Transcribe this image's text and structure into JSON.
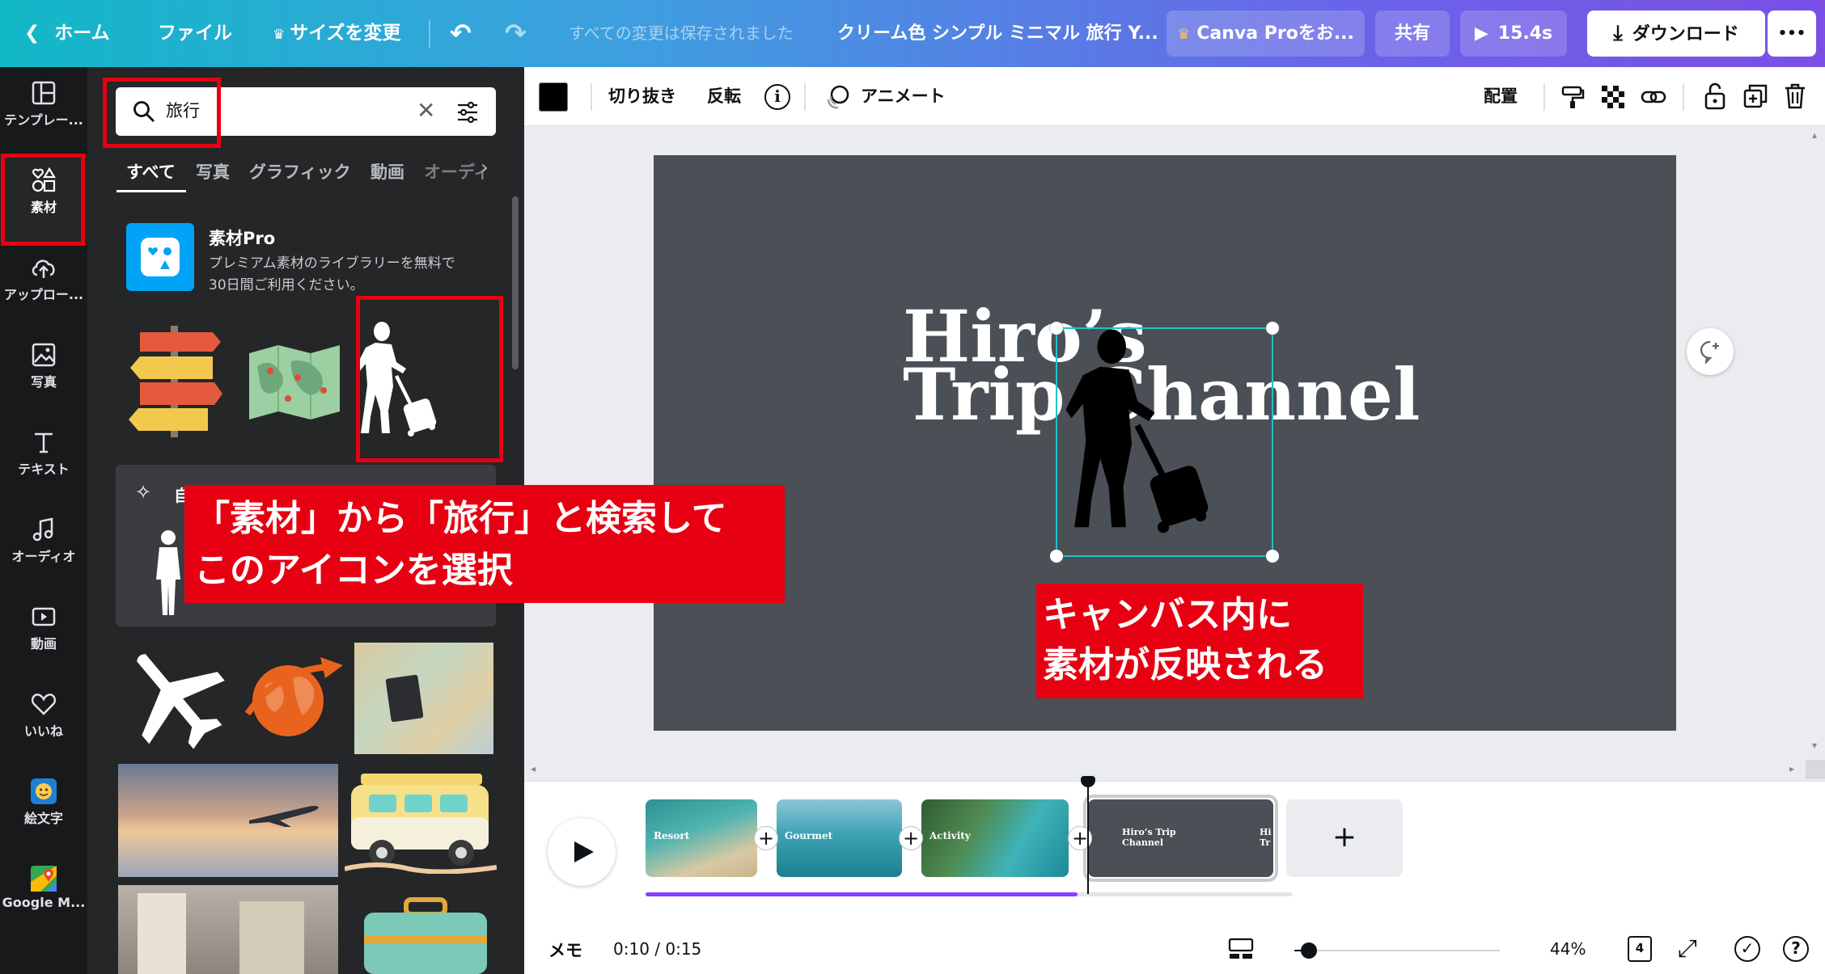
{
  "topbar": {
    "home": "ホーム",
    "file": "ファイル",
    "resize": "サイズを変更",
    "saved_status": "すべての変更は保存されました",
    "doc_title": "クリーム色 シンプル ミニマル 旅行 Y...",
    "pro_button": "Canva Proをお...",
    "share": "共有",
    "duration": "15.4s",
    "download": "ダウンロード",
    "more": "•••"
  },
  "rail": {
    "items": [
      {
        "label": "テンプレー..."
      },
      {
        "label": "素材"
      },
      {
        "label": "アップロー..."
      },
      {
        "label": "写真"
      },
      {
        "label": "テキスト"
      },
      {
        "label": "オーディオ"
      },
      {
        "label": "動画"
      },
      {
        "label": "いいね"
      },
      {
        "label": "絵文字"
      },
      {
        "label": "Google M..."
      }
    ]
  },
  "panel": {
    "search_value": "旅行",
    "tabs": [
      "すべて",
      "写真",
      "グラフィック",
      "動画",
      "オーディ"
    ],
    "promo_title": "素材Pro",
    "promo_line1": "プレミアム素材のライブラリーを無料で",
    "promo_line2": "30日間ご利用ください。",
    "magic_label": "自"
  },
  "toolbar": {
    "crop": "切り抜き",
    "flip": "反転",
    "animate": "アニメート",
    "position": "配置"
  },
  "canvas": {
    "title_line1": "Hiro’s",
    "title_line2": "Trip Channel"
  },
  "timeline": {
    "clips": [
      {
        "label": "Resort"
      },
      {
        "label": "Gourmet"
      },
      {
        "label": "Activity"
      },
      {
        "label": "Hiro’s Trip Channel"
      }
    ],
    "clip5_fragment": "Hi Tr",
    "add": "+",
    "progress": 0.667
  },
  "bottombar": {
    "notes": "メモ",
    "time": "0:10 / 0:15",
    "zoom": "44%",
    "pages": "4",
    "help": "?"
  },
  "annotations": {
    "callout1_line1": "「素材」から「旅行」と検索して",
    "callout1_line2": "このアイコンを選択",
    "callout2_line1": "キャンバス内に",
    "callout2_line2": "素材が反映される"
  },
  "colors": {
    "accent_red": "#e60012",
    "selection": "#1fc3cf",
    "progress": "#8b3dff"
  }
}
